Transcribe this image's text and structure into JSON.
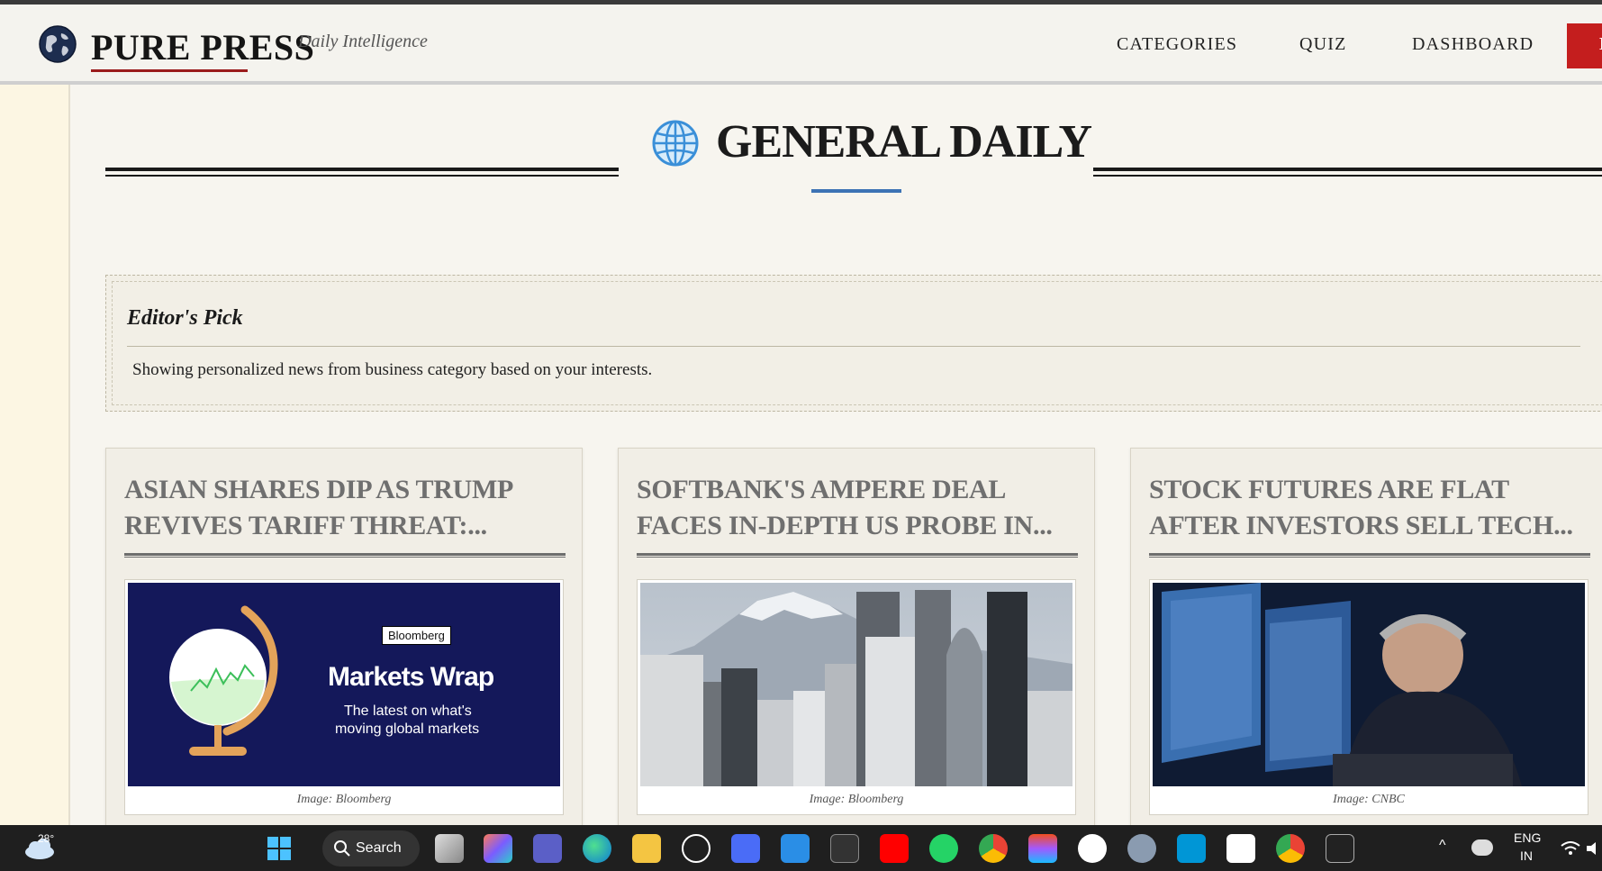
{
  "header": {
    "brand": "PURE PRESS",
    "tagline": "Daily Intelligence",
    "nav": [
      "CATEGORIES",
      "QUIZ",
      "DASHBOARD"
    ],
    "nav_partial": "L"
  },
  "section": {
    "title": "GENERAL DAILY"
  },
  "editors_pick": {
    "title": "Editor's Pick",
    "text": "Showing personalized news from business category based on your interests."
  },
  "cards": [
    {
      "headline": "ASIAN SHARES DIP AS TRUMP REVIVES TARIFF THREAT:...",
      "caption": "Image: Bloomberg",
      "image": {
        "badge": "Bloomberg",
        "title": "Markets Wrap",
        "subtitle_line1": "The latest on what's",
        "subtitle_line2": "moving global markets"
      }
    },
    {
      "headline": "SOFTBANK'S AMPERE DEAL FACES IN-DEPTH US PROBE IN...",
      "caption": "Image: Bloomberg"
    },
    {
      "headline": "STOCK FUTURES ARE FLAT AFTER INVESTORS SELL TECH...",
      "caption": "Image: CNBC"
    }
  ],
  "taskbar": {
    "weather_temp": "28°",
    "search_label": "Search",
    "lang_line1": "ENG",
    "lang_line2": "IN"
  },
  "colors": {
    "accent_red": "#c41e1e",
    "accent_blue": "#3d73b5",
    "bloomberg_navy": "#14185a"
  }
}
